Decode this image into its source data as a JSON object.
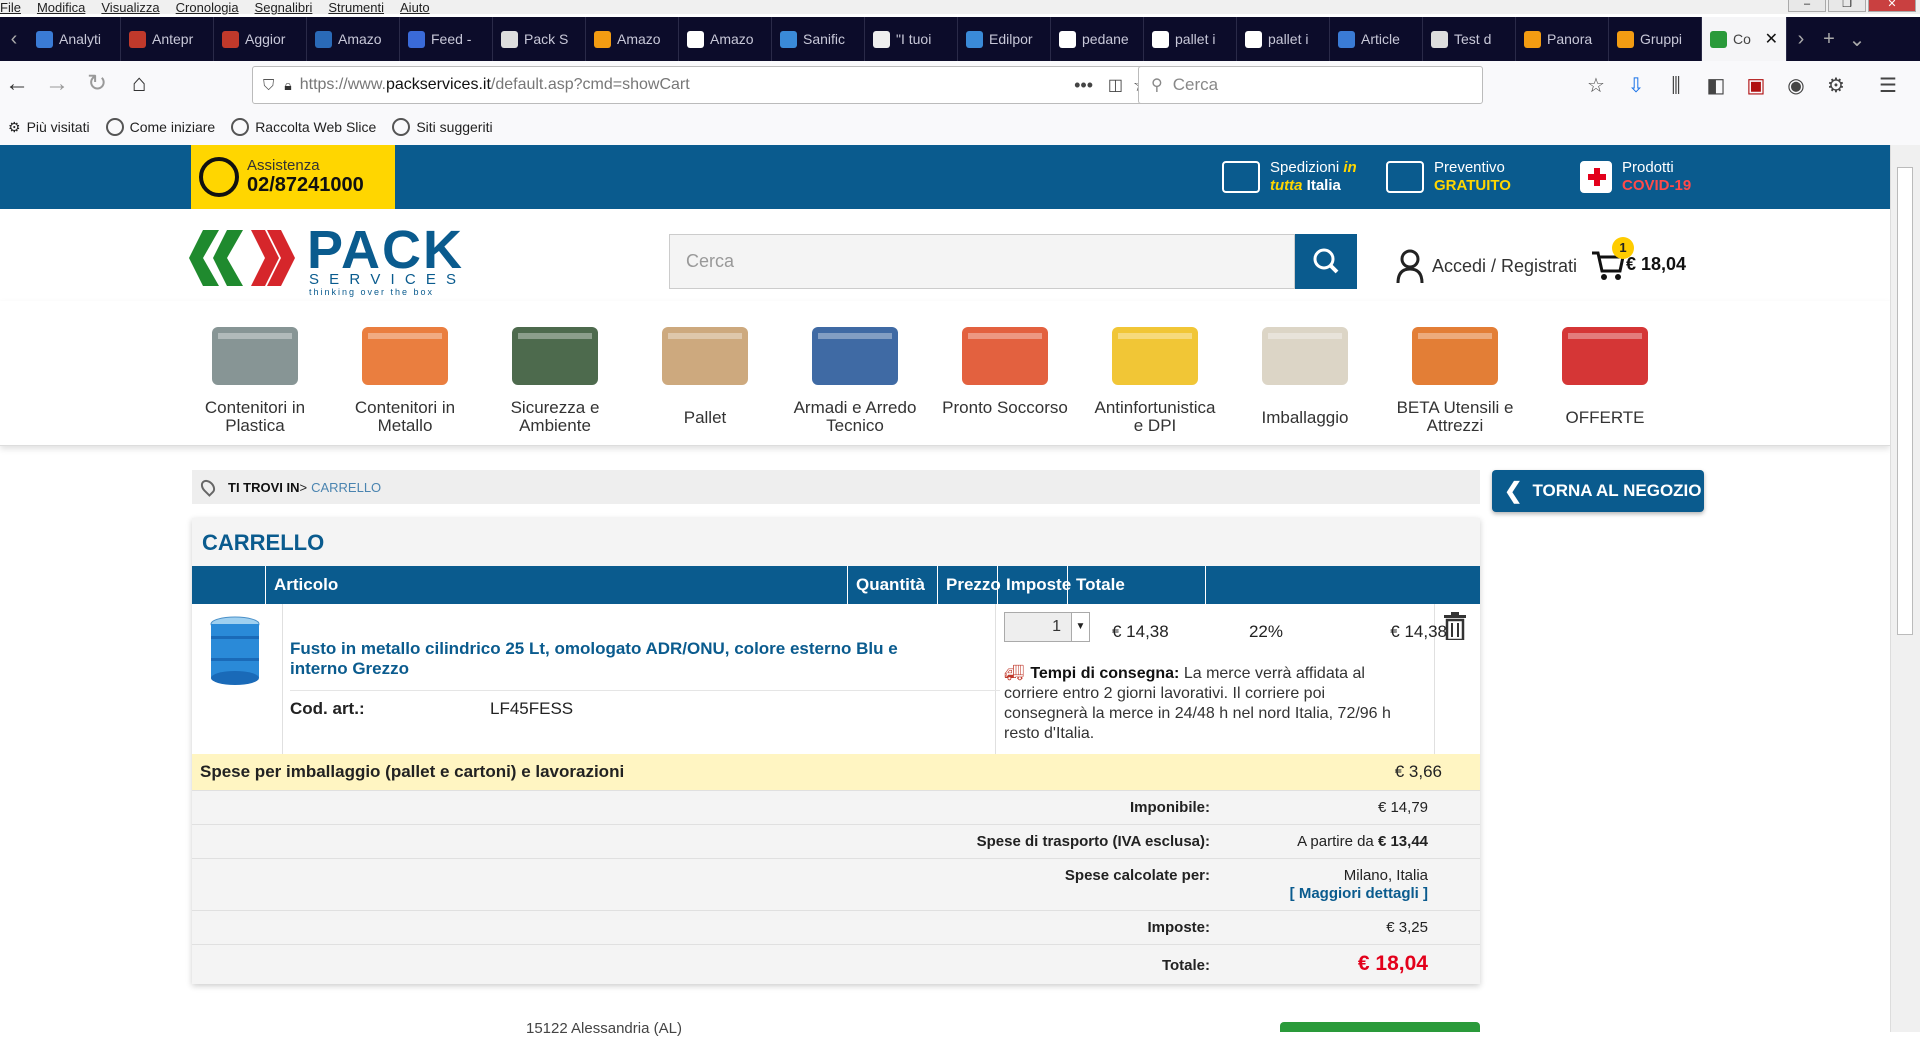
{
  "menubar": [
    "File",
    "Modifica",
    "Visualizza",
    "Cronologia",
    "Segnalibri",
    "Strumenti",
    "Aiuto"
  ],
  "tabs": [
    {
      "label": "Analyti",
      "color": "#3a7bd5"
    },
    {
      "label": "Antepr",
      "color": "#c0392b"
    },
    {
      "label": "Aggior",
      "color": "#c0392b"
    },
    {
      "label": "Amazo",
      "color": "#2a6ab8"
    },
    {
      "label": "Feed -",
      "color": "#3a6ad8"
    },
    {
      "label": "Pack S",
      "color": "#ddd"
    },
    {
      "label": "Amazo",
      "color": "#f39c12"
    },
    {
      "label": "Amazo",
      "color": "#fff"
    },
    {
      "label": "Sanific",
      "color": "#3a8ad8"
    },
    {
      "label": "\"I tuoi",
      "color": "#eee"
    },
    {
      "label": "Edilpor",
      "color": "#3a8ad8"
    },
    {
      "label": "pedane",
      "color": "#fff"
    },
    {
      "label": "pallet i",
      "color": "#fff"
    },
    {
      "label": "pallet i",
      "color": "#fff"
    },
    {
      "label": "Article",
      "color": "#3a7bd5"
    },
    {
      "label": "Test d",
      "color": "#ddd"
    },
    {
      "label": "Panora",
      "color": "#f39c12"
    },
    {
      "label": "Gruppi",
      "color": "#f39c12"
    },
    {
      "label": "Co",
      "color": "#2a9a3a",
      "active": true
    }
  ],
  "browser": {
    "url_prefix": "https://www.",
    "url_domain": "packservices.it",
    "url_path": "/default.asp?cmd=showCart",
    "search_placeholder": "Cerca"
  },
  "bookmarks": [
    "Più visitati",
    "Come iniziare",
    "Raccolta Web Slice",
    "Siti suggeriti"
  ],
  "topbar": {
    "assist_label": "Assistenza",
    "assist_phone": "02/87241000",
    "feature1_line1": "Spedizioni ",
    "feature1_in": "in",
    "feature1_line2a": "tutta",
    "feature1_line2b": " Italia",
    "feature2_line1": "Preventivo",
    "feature2_line2": "GRATUITO",
    "feature3_line1": "Prodotti",
    "feature3_line2": "COVID-19"
  },
  "header": {
    "logo_main": "PACK",
    "logo_sub": "S E R V I C E S",
    "logo_tag": "thinking over the box",
    "search_placeholder": "Cerca",
    "account_label": "Accedi / Registrati",
    "cart_count": "1",
    "cart_total": "€ 18,04"
  },
  "categories": [
    {
      "label": "Contenitori in Plastica",
      "color": "#7a8a8a"
    },
    {
      "label": "Contenitori in Metallo",
      "color": "#e8702a"
    },
    {
      "label": "Sicurezza e Ambiente",
      "color": "#3a5a3a"
    },
    {
      "label": "Pallet",
      "color": "#c8a070"
    },
    {
      "label": "Armadi e Arredo Tecnico",
      "color": "#2a5a9a"
    },
    {
      "label": "Pronto Soccorso",
      "color": "#e0502a"
    },
    {
      "label": "Antinfortunistica e DPI",
      "color": "#f0c020"
    },
    {
      "label": "Imballaggio",
      "color": "#d8d0c0"
    },
    {
      "label": "BETA Utensili e Attrezzi",
      "color": "#e07020"
    },
    {
      "label": "OFFERTE",
      "color": "#d02020"
    }
  ],
  "breadcrumb": {
    "label": "TI TROVI IN",
    "sep": " > ",
    "current": "CARRELLO"
  },
  "back_button": "TORNA AL NEGOZIO",
  "cart": {
    "title": "CARRELLO",
    "columns": [
      "Articolo",
      "Quantità",
      "Prezzo",
      "Imposte",
      "Totale"
    ],
    "item": {
      "name": "Fusto in metallo cilindrico 25 Lt, omologato ADR/ONU, colore esterno Blu e interno Grezzo",
      "code_label": "Cod. art.:",
      "code": "LF45FESS",
      "qty": "1",
      "price": "€ 14,38",
      "tax": "22%",
      "total": "€ 14,38",
      "delivery_label": "Tempi di consegna:",
      "delivery_text": " La merce verrà affidata al corriere entro 2 giorni lavorativi. Il corriere poi consegnerà la merce in 24/48 h nel nord Italia, 72/96 h resto d'Italia."
    },
    "packaging_label": "Spese per imballaggio (pallet e cartoni) e lavorazioni",
    "packaging_value": "€ 3,66",
    "imponibile_label": "Imponibile:",
    "imponibile_value": "€ 14,79",
    "shipping_label": "Spese di trasporto (IVA esclusa):",
    "shipping_prefix": "A partire da ",
    "shipping_value": "€ 13,44",
    "calc_label": "Spese calcolate per:",
    "calc_value": "Milano, Italia",
    "details_link": "[ Maggiori dettagli ]",
    "taxes_label": "Imposte:",
    "taxes_value": "€ 3,25",
    "total_label": "Totale:",
    "total_value": "€ 18,04"
  },
  "footer_text": "15122 Alessandria (AL)"
}
